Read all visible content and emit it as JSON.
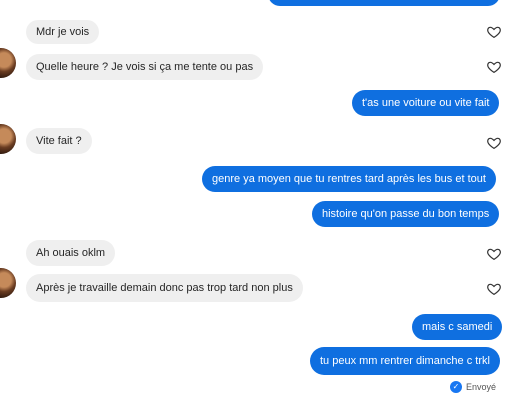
{
  "colors": {
    "incoming_bubble": "#efefef",
    "outgoing_bubble": "#0f6fe0",
    "text_dark": "#262626"
  },
  "messages": [
    {
      "text": "Mdr je vois"
    },
    {
      "text": "Quelle heure ? Je vois si ça me tente ou pas"
    },
    {
      "text": "t'as une voiture ou vite fait"
    },
    {
      "text": "Vite fait ?"
    },
    {
      "text": "genre ya moyen que tu rentres tard après les bus et tout"
    },
    {
      "text": "histoire qu'on passe du bon temps"
    },
    {
      "text": "Ah ouais oklm"
    },
    {
      "text": "Après je travaille demain donc pas trop tard non plus"
    },
    {
      "text": "mais c samedi"
    },
    {
      "text": "tu peux mm rentrer dimanche c trkl"
    }
  ],
  "status": {
    "label": "Envoyé"
  },
  "icons": {
    "react": "heart-outline-icon",
    "sent": "sent-check-icon"
  }
}
